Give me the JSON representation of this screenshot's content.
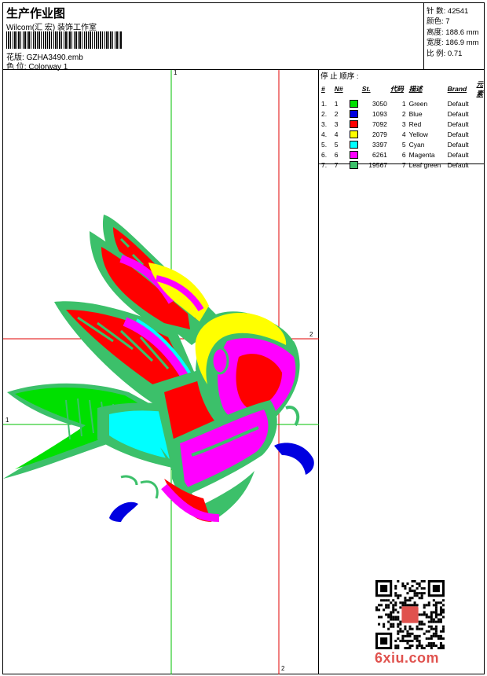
{
  "header": {
    "title": "生产作业图",
    "company": "Wilcom(汇 宏) 装饰工作室",
    "pattern_label": "花版:",
    "pattern_file": "GZHA3490.emb",
    "colorway_label": "色 位:",
    "colorway": "Colorway 1"
  },
  "stats": {
    "stitches_label": "针 数:",
    "stitches": "42541",
    "colors_label": "颜色:",
    "colors": "7",
    "height_label": "高度:",
    "height": "188.6 mm",
    "width_label": "宽度:",
    "width": "186.9 mm",
    "scale_label": "比 例:",
    "scale": "0.71"
  },
  "stop_sequence": {
    "title": "停 止 顺序 :",
    "headers": [
      "#",
      "N#",
      "St.",
      "代码",
      "描述",
      "Brand",
      "元素"
    ],
    "rows": [
      {
        "idx": "1.",
        "n": "1",
        "st": "3050",
        "code": "1",
        "desc": "Green",
        "brand": "Default",
        "color": "#00e000"
      },
      {
        "idx": "2.",
        "n": "2",
        "st": "1093",
        "code": "2",
        "desc": "Blue",
        "brand": "Default",
        "color": "#0000e0"
      },
      {
        "idx": "3.",
        "n": "3",
        "st": "7092",
        "code": "3",
        "desc": "Red",
        "brand": "Default",
        "color": "#ff0000"
      },
      {
        "idx": "4.",
        "n": "4",
        "st": "2079",
        "code": "4",
        "desc": "Yellow",
        "brand": "Default",
        "color": "#ffff00"
      },
      {
        "idx": "5.",
        "n": "5",
        "st": "3397",
        "code": "5",
        "desc": "Cyan",
        "brand": "Default",
        "color": "#00ffff"
      },
      {
        "idx": "6.",
        "n": "6",
        "st": "6261",
        "code": "6",
        "desc": "Magenta",
        "brand": "Default",
        "color": "#ff00ff"
      },
      {
        "idx": "7.",
        "n": "7",
        "st": "19567",
        "code": "7",
        "desc": "Leaf green",
        "brand": "Default",
        "color": "#3cc06a"
      }
    ]
  },
  "guides": {
    "v1_top": "1",
    "v2_bottom": "2",
    "h1_left": "1",
    "h2_right": "2"
  },
  "watermark": "6xiu.com"
}
